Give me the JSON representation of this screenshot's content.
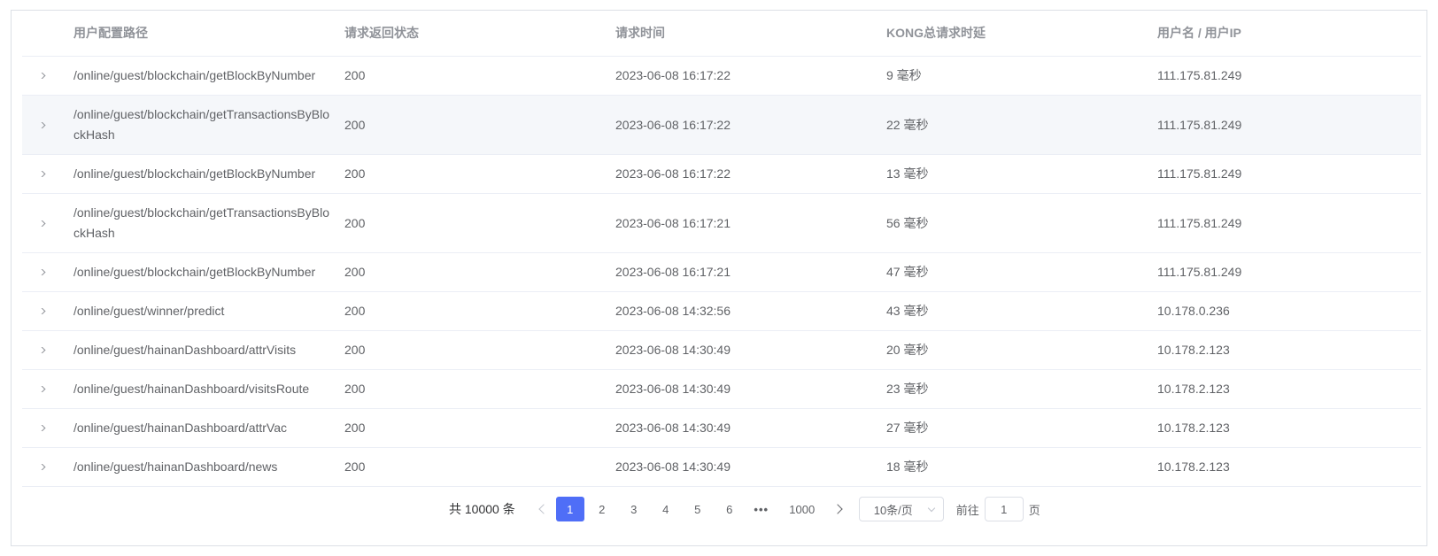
{
  "table": {
    "columns": [
      "用户配置路径",
      "请求返回状态",
      "请求时间",
      "KONG总请求时延",
      "用户名 / 用户IP"
    ],
    "rows": [
      {
        "path": "/online/guest/blockchain/getBlockByNumber",
        "status": "200",
        "time": "2023-06-08 16:17:22",
        "latency": "9 毫秒",
        "user": "111.175.81.249"
      },
      {
        "path": "/online/guest/blockchain/getTransactionsByBlockHash",
        "status": "200",
        "time": "2023-06-08 16:17:22",
        "latency": "22 毫秒",
        "user": "111.175.81.249"
      },
      {
        "path": "/online/guest/blockchain/getBlockByNumber",
        "status": "200",
        "time": "2023-06-08 16:17:22",
        "latency": "13 毫秒",
        "user": "111.175.81.249"
      },
      {
        "path": "/online/guest/blockchain/getTransactionsByBlockHash",
        "status": "200",
        "time": "2023-06-08 16:17:21",
        "latency": "56 毫秒",
        "user": "111.175.81.249"
      },
      {
        "path": "/online/guest/blockchain/getBlockByNumber",
        "status": "200",
        "time": "2023-06-08 16:17:21",
        "latency": "47 毫秒",
        "user": "111.175.81.249"
      },
      {
        "path": "/online/guest/winner/predict",
        "status": "200",
        "time": "2023-06-08 14:32:56",
        "latency": "43 毫秒",
        "user": "10.178.0.236"
      },
      {
        "path": "/online/guest/hainanDashboard/attrVisits",
        "status": "200",
        "time": "2023-06-08 14:30:49",
        "latency": "20 毫秒",
        "user": "10.178.2.123"
      },
      {
        "path": "/online/guest/hainanDashboard/visitsRoute",
        "status": "200",
        "time": "2023-06-08 14:30:49",
        "latency": "23 毫秒",
        "user": "10.178.2.123"
      },
      {
        "path": "/online/guest/hainanDashboard/attrVac",
        "status": "200",
        "time": "2023-06-08 14:30:49",
        "latency": "27 毫秒",
        "user": "10.178.2.123"
      },
      {
        "path": "/online/guest/hainanDashboard/news",
        "status": "200",
        "time": "2023-06-08 14:30:49",
        "latency": "18 毫秒",
        "user": "10.178.2.123"
      }
    ]
  },
  "pagination": {
    "total_label": "共 10000 条",
    "pages": [
      "1",
      "2",
      "3",
      "4",
      "5",
      "6"
    ],
    "current_page": "1",
    "ellipsis": "•••",
    "last_page": "1000",
    "page_size_label": "10条/页",
    "goto_prefix": "前往",
    "goto_value": "1",
    "goto_suffix": "页"
  },
  "colors": {
    "accent": "#4f6ef7",
    "hover_row": "#f5f7fa",
    "border": "#ebeef5"
  }
}
